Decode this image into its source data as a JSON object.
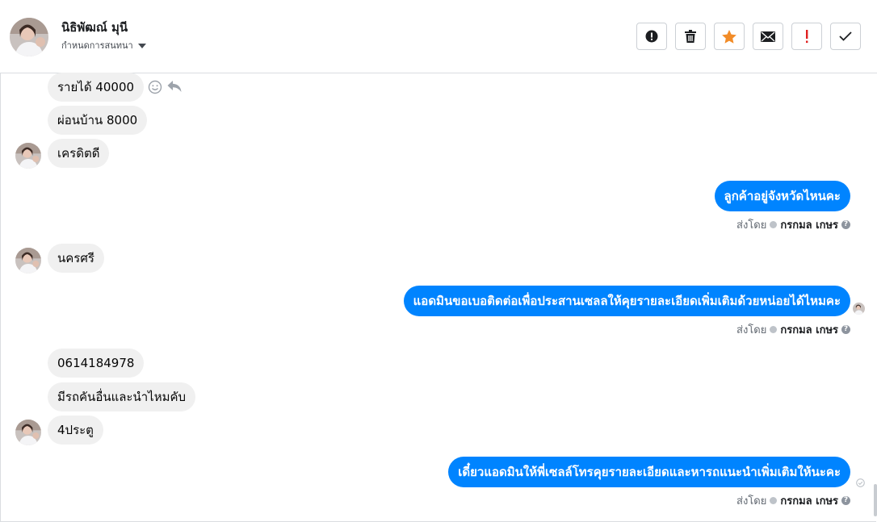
{
  "header": {
    "contact_name": "นิธิพัฒณ์ มุนี",
    "assign_label": "กำหนดการสนทนา",
    "toolbar": [
      {
        "name": "spam-button",
        "icon": "alert-circle-icon"
      },
      {
        "name": "delete-button",
        "icon": "trash-icon"
      },
      {
        "name": "star-button",
        "icon": "star-icon",
        "color": "#f28c28"
      },
      {
        "name": "mark-unread-button",
        "icon": "envelope-icon"
      },
      {
        "name": "follow-up-button",
        "icon": "exclamation-icon",
        "color": "#e02020"
      },
      {
        "name": "done-button",
        "icon": "check-icon"
      }
    ]
  },
  "messages": {
    "in1": "รายได้ 40000",
    "in2": "ผ่อนบ้าน 8000",
    "in3": "เครดิตดี",
    "out1": "ลูกค้าอยู่จังหวัดไหนคะ",
    "in4": "นครศรี",
    "out2": "แอดมินขอเบอติดต่อเพื่อประสานเซลลให้คุยรายละเอียดเพิ่มเติมด้วยหน่อยได้ไหมคะ",
    "in5": "0614184978",
    "in6": "มีรถคันอื่นและนำไหมคับ",
    "in7": "4ประตู",
    "out3": "เดี๋ยวแอดมินให้พี่เซลล์โทรคุยรายละเอียดและหารถแนะนำเพิ่มเติมให้นะคะ"
  },
  "sent_by": {
    "prefix": "ส่งโดย",
    "agent": "กรกมล เกษร"
  },
  "colors": {
    "outgoing_bubble": "#0084ff",
    "incoming_bubble": "#f0f0f0"
  }
}
